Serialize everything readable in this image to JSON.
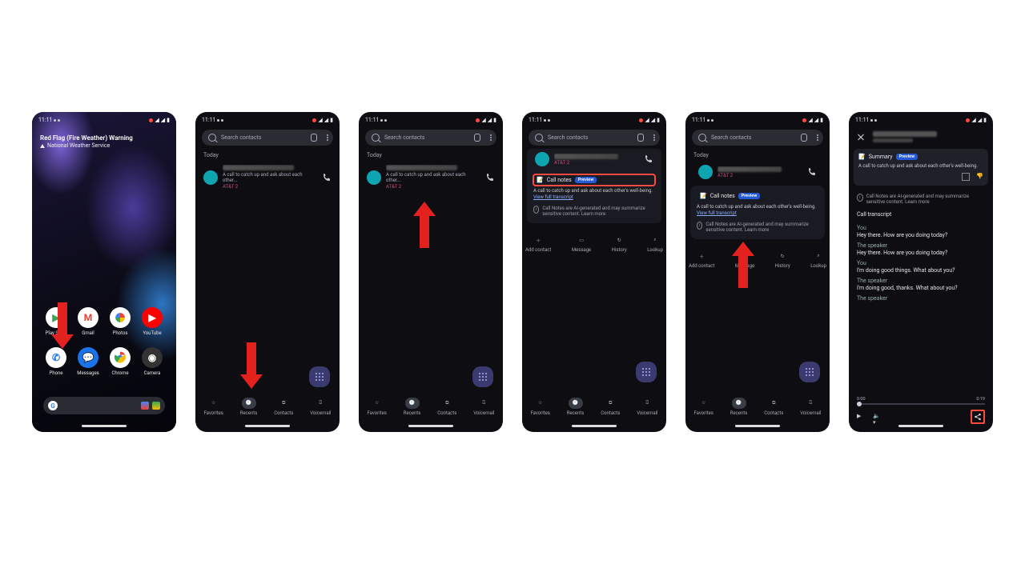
{
  "status_time": "11:11",
  "home": {
    "notif_title": "Red Flag (Fire Weather) Warning",
    "notif_source": "National Weather Service",
    "apps_row1": [
      "Play Store",
      "Gmail",
      "Photos",
      "YouTube"
    ],
    "apps_row2": [
      "Phone",
      "Messages",
      "Chrome",
      "Camera"
    ]
  },
  "phone_app": {
    "search_placeholder": "Search contacts",
    "today": "Today",
    "call_sub": "A call to catch up and ask about each other...",
    "carrier": "AT&T 2",
    "nav": [
      "Favorites",
      "Recents",
      "Contacts",
      "Voicemail"
    ]
  },
  "detail": {
    "call_notes_label": "Call notes",
    "badge": "Preview",
    "cn_text_a": "A call to catch up and ask about each other's well-being.",
    "transcript_link": "View full transcript",
    "ai_note": "Call Notes are AI-generated and may summarize sensitive content. Learn more",
    "actions": [
      "Add contact",
      "Message",
      "History",
      "Lookup"
    ]
  },
  "transcript": {
    "summary_label": "Summary",
    "summary_text": "A call to catch up and ask about each other's well-being.",
    "ai_note": "Call Notes are AI-generated and may summarize sensitive content. Learn more",
    "section_label": "Call transcript",
    "lines": [
      {
        "speaker": "You",
        "text": "Hey there. How are you doing today?"
      },
      {
        "speaker": "The speaker",
        "text": "Hey there. How are you doing today?"
      },
      {
        "speaker": "You",
        "text": "I'm doing good things. What about you?"
      },
      {
        "speaker": "The speaker",
        "text": "I'm doing good, thanks. What about you?"
      },
      {
        "speaker": "The speaker",
        "text": ""
      }
    ],
    "time_start": "0:00",
    "time_end": "0:19"
  }
}
